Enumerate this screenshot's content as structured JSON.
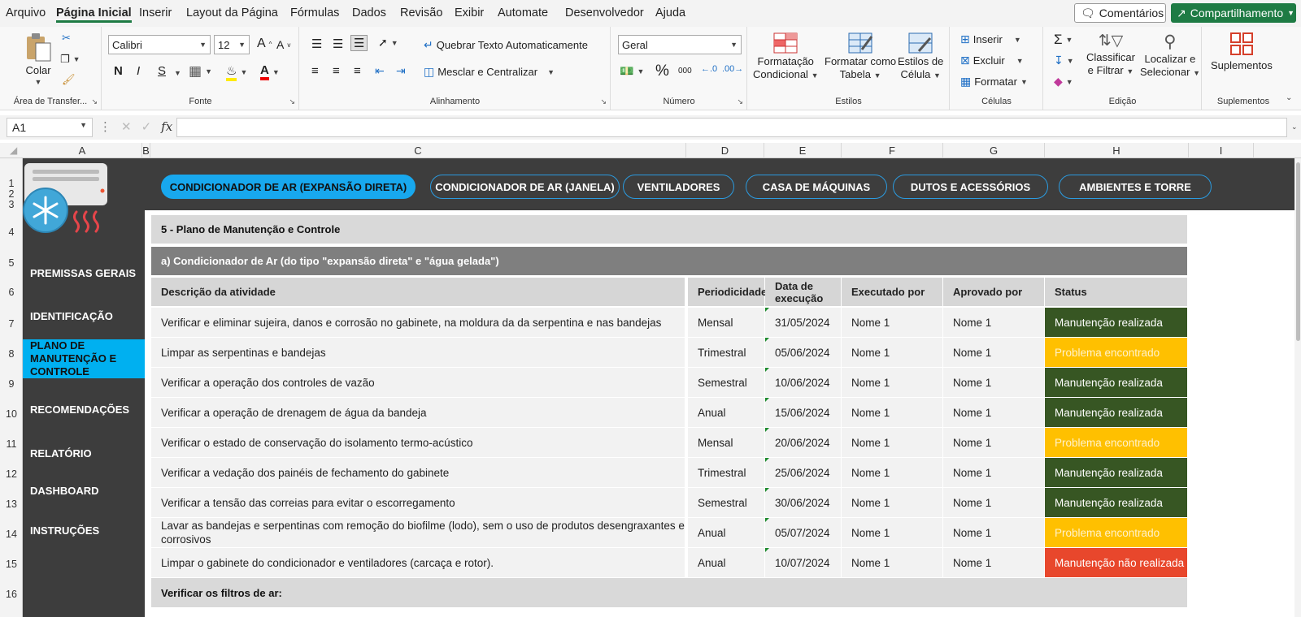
{
  "menu": {
    "items": [
      "Arquivo",
      "Página Inicial",
      "Inserir",
      "Layout da Página",
      "Fórmulas",
      "Dados",
      "Revisão",
      "Exibir",
      "Automate",
      "Desenvolvedor",
      "Ajuda"
    ],
    "comments_label": "Comentários",
    "share_label": "Compartilhamento"
  },
  "ribbon": {
    "clipboard": {
      "title": "Área de Transfer...",
      "paste": "Colar"
    },
    "font": {
      "title": "Fonte",
      "family": "Calibri",
      "size": "12",
      "bold": "N",
      "italic": "I",
      "underline": "S"
    },
    "alignment": {
      "title": "Alinhamento",
      "wrap": "Quebrar Texto Automaticamente",
      "merge": "Mesclar e Centralizar"
    },
    "number": {
      "title": "Número",
      "format": "Geral",
      "percent": "%",
      "thousands": "000"
    },
    "styles": {
      "title": "Estilos",
      "conditional": [
        "Formatação",
        "Condicional"
      ],
      "as_table": [
        "Formatar como",
        "Tabela"
      ],
      "cell_styles": [
        "Estilos de",
        "Célula"
      ]
    },
    "cells": {
      "title": "Células",
      "insert": "Inserir",
      "delete": "Excluir",
      "format": "Formatar"
    },
    "editing": {
      "title": "Edição",
      "sort": [
        "Classificar",
        "e Filtrar"
      ],
      "find": [
        "Localizar e",
        "Selecionar"
      ]
    },
    "addins": {
      "title": "Suplementos",
      "label": "Suplementos"
    }
  },
  "formula_bar": {
    "name_box": "A1",
    "fx": "fx",
    "value": ""
  },
  "columns": [
    "A",
    "B",
    "C",
    "D",
    "E",
    "F",
    "G",
    "H",
    "I"
  ],
  "rows": [
    "1",
    "2",
    "3",
    "4",
    "5",
    "6",
    "7",
    "8",
    "9",
    "10",
    "11",
    "12",
    "13",
    "14",
    "15",
    "16"
  ],
  "nav_tabs": [
    {
      "label": "CONDICIONADOR DE AR (EXPANSÃO DIRETA)",
      "active": true
    },
    {
      "label": "CONDICIONADOR DE AR (JANELA)",
      "active": false
    },
    {
      "label": "VENTILADORES",
      "active": false
    },
    {
      "label": "CASA DE MÁQUINAS",
      "active": false
    },
    {
      "label": "DUTOS E ACESSÓRIOS",
      "active": false
    },
    {
      "label": "AMBIENTES E TORRE",
      "active": false
    }
  ],
  "sidebar": [
    {
      "label": "PREMISSAS GERAIS",
      "active": false
    },
    {
      "label": "IDENTIFICAÇÃO",
      "active": false
    },
    {
      "label": "PLANO DE MANUTENÇÃO E CONTROLE",
      "active": true
    },
    {
      "label": "RECOMENDAÇÕES",
      "active": false
    },
    {
      "label": "RELATÓRIO",
      "active": false
    },
    {
      "label": "DASHBOARD",
      "active": false
    },
    {
      "label": "INSTRUÇÕES",
      "active": false
    }
  ],
  "section_title": "5 - Plano de Manutenção e Controle",
  "subsection_title": "a) Condicionador de Ar (do tipo \"expansão direta\" e \"água gelada\")",
  "table": {
    "headers": [
      "Descrição da atividade",
      "Periodicidade",
      "Data de execução",
      "Executado por",
      "Aprovado por",
      "Status"
    ],
    "rows": [
      [
        "Verificar e eliminar sujeira, danos e corrosão no gabinete, na moldura da da serpentina e nas bandejas",
        "Mensal",
        "31/05/2024",
        "Nome 1",
        "Nome 1",
        "Manutenção realizada"
      ],
      [
        "Limpar as serpentinas e bandejas",
        "Trimestral",
        "05/06/2024",
        "Nome 1",
        "Nome 1",
        "Problema encontrado"
      ],
      [
        "Verificar a operação dos controles de vazão",
        "Semestral",
        "10/06/2024",
        "Nome 1",
        "Nome 1",
        "Manutenção realizada"
      ],
      [
        "Verificar a operação de drenagem de água da bandeja",
        "Anual",
        "15/06/2024",
        "Nome 1",
        "Nome 1",
        "Manutenção realizada"
      ],
      [
        "Verificar o estado de conservação do isolamento termo-acústico",
        "Mensal",
        "20/06/2024",
        "Nome 1",
        "Nome 1",
        "Problema encontrado"
      ],
      [
        "Verificar a vedação dos painéis de fechamento do gabinete",
        "Trimestral",
        "25/06/2024",
        "Nome 1",
        "Nome 1",
        "Manutenção realizada"
      ],
      [
        "Verificar a tensão das correias para evitar o escorregamento",
        "Semestral",
        "30/06/2024",
        "Nome 1",
        "Nome 1",
        "Manutenção realizada"
      ],
      [
        "Lavar as bandejas e serpentinas com remoção do biofilme (lodo), sem o uso de produtos desengraxantes e corrosivos",
        "Anual",
        "05/07/2024",
        "Nome 1",
        "Nome 1",
        "Problema encontrado"
      ],
      [
        "Limpar o gabinete do condicionador e ventiladores (carcaça e rotor).",
        "Anual",
        "10/07/2024",
        "Nome 1",
        "Nome 1",
        "Manutenção não realizada"
      ]
    ],
    "next_section": "Verificar os filtros de ar:"
  },
  "status_colors": {
    "Manutenção realizada": {
      "bg": "#375623",
      "fg": "#ffffff"
    },
    "Problema encontrado": {
      "bg": "#ffc000",
      "fg": "#fff2cc"
    },
    "Manutenção não realizada": {
      "bg": "#e8472c",
      "fg": "#ffffff"
    }
  },
  "theme": {
    "dark_panel": "#3d3d3d",
    "accent": "#00b0f0",
    "excel_green": "#1e7b44"
  }
}
